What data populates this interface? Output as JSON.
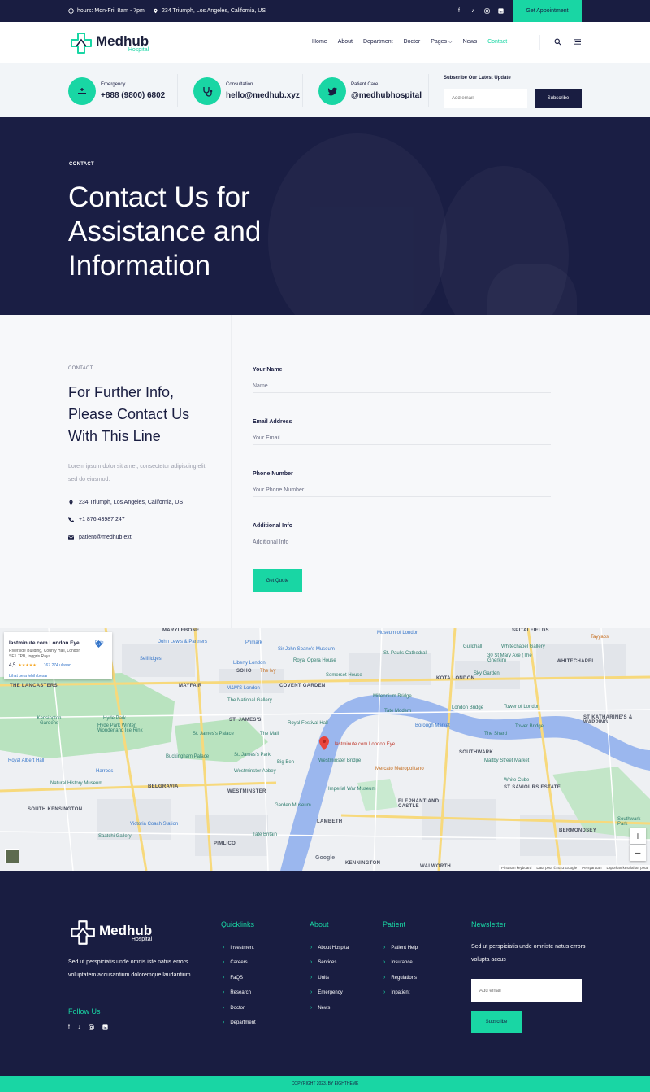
{
  "topbar": {
    "hours": "hours: Mon-Fri: 8am - 7pm",
    "address": "234 Triumph, Los Angeles, California, US",
    "appointment_label": "Get Appointment"
  },
  "brand": {
    "name": "Medhub",
    "sub": "Hospital"
  },
  "nav": {
    "items": [
      "Home",
      "About",
      "Department",
      "Doctor",
      "Pages",
      "News",
      "Contact"
    ],
    "active": "Contact"
  },
  "strip": {
    "emergency": {
      "label": "Emergency",
      "value": "+888 (9800) 6802"
    },
    "consultation": {
      "label": "Consultation",
      "value": "hello@medhub.xyz"
    },
    "patient_care": {
      "label": "Patient Care",
      "value": "@medhubhospital"
    },
    "subscribe_title": "Subscribe Our Latest Update",
    "subscribe_placeholder": "Add email",
    "subscribe_button": "Subscribe"
  },
  "hero": {
    "kicker": "CONTACT",
    "title": "Contact Us for Assistance and Information"
  },
  "contact": {
    "kicker": "CONTACT",
    "title": "For Further Info, Please Contact Us With This Line",
    "description": "Lorem ipsum dolor sit amet, consectetur adipiscing elit, sed do eiusmod.",
    "address": "234 Triumph, Los Angeles, California, US",
    "phone": "+1 876 43987 247",
    "email": "patient@medhub.ext"
  },
  "form": {
    "name_label": "Your Name",
    "name_placeholder": "Name",
    "email_label": "Email Address",
    "email_placeholder": "Your Email",
    "phone_label": "Phone Number",
    "phone_placeholder": "Your Phone Number",
    "info_label": "Additional Info",
    "info_placeholder": "Additional Info",
    "submit": "Get Quote"
  },
  "map": {
    "card_title": "lastminute.com London Eye",
    "card_address": "Riverside Building, County Hall, London SE1 7PB, Inggris Raya",
    "rating": "4,5",
    "stars": "★★★★★",
    "reviews": "167.274 ulasan",
    "larger_map": "Lihat peta lebih besar",
    "route": "Rute",
    "marker_label": "lastminute.com London Eye",
    "areas": [
      "MARYLEBONE",
      "SPITALFIELDS",
      "WHITECHAPEL",
      "SOHO",
      "THE LANCASTERS",
      "MAYFAIR",
      "COVENT GARDEN",
      "KOTA LONDON",
      "ST. JAMES'S",
      "ST KATHARINE'S & WAPPING",
      "BELGRAVIA",
      "WESTMINSTER",
      "SOUTHWARK",
      "ST SAVIOURS ESTATE",
      "SOUTH KENSINGTON",
      "LAMBETH",
      "ELEPHANT AND CASTLE",
      "BERMONDSEY",
      "PIMLICO",
      "KENNINGTON",
      "WALWORTH"
    ],
    "pois": [
      "Museum of London",
      "John Lewis & Partners",
      "Sir John Soane's Museum",
      "Primark",
      "Whitechapel Gallery",
      "Tayyabs",
      "Selfridges",
      "Liberty London",
      "Royal Opera House",
      "St. Paul's Cathedral",
      "30 St Mary Axe (The Gherkin)",
      "Guildhall",
      "Sky Garden",
      "The Ivy",
      "Somerset House",
      "M&M'S London",
      "The National Gallery",
      "Millennium Bridge",
      "Tower of London",
      "Tate Modern",
      "London Bridge",
      "Borough Market",
      "Tower Bridge",
      "The Shard",
      "Royal Festival Hall",
      "Kensington Gardens",
      "Hyde Park",
      "Hyde Park Winter Wonderland Ice Rink",
      "St. James's Palace",
      "The Mall",
      "Buckingham Palace",
      "Royal Albert Hall",
      "Harrods",
      "St. James's Park",
      "Big Ben",
      "Westminster Bridge",
      "Westminster Abbey",
      "Mercato Metropolitano",
      "Maltby Street Market",
      "White Cube",
      "Natural History Museum",
      "Imperial War Museum",
      "Garden Museum",
      "Victoria Coach Station",
      "Saatchi Gallery",
      "Tate Britain",
      "Southwark Park"
    ],
    "footer": [
      "Pintasan keyboard",
      "Data peta ©2023 Google",
      "Persyaratan",
      "Laporkan kesalahan peta"
    ],
    "google": "Google"
  },
  "footer": {
    "description": "Sed ut perspiciatis unde omnis iste natus errors voluptatem accusantium doloremque laudantium.",
    "follow": "Follow Us",
    "quicklinks_title": "Quicklinks",
    "quicklinks": [
      "Investment",
      "Careers",
      "FaQS",
      "Research",
      "Doctor",
      "Department"
    ],
    "about_title": "About",
    "about": [
      "About Hospital",
      "Services",
      "Units",
      "Emergency",
      "News"
    ],
    "patient_title": "Patient",
    "patient": [
      "Patient Help",
      "Insurance",
      "Regulations",
      "Inpatient"
    ],
    "newsletter_title": "Newsletter",
    "newsletter_text": "Sed ut perspiciatis unde omniste natus errors volupta accus",
    "newsletter_placeholder": "Add email",
    "newsletter_button": "Subscribe",
    "copyright": "COPYRIGHT 2023. BY EIGHTHEME"
  },
  "colors": {
    "navy": "#191d41",
    "accent": "#19d6a4",
    "light": "#f2f5f8"
  }
}
